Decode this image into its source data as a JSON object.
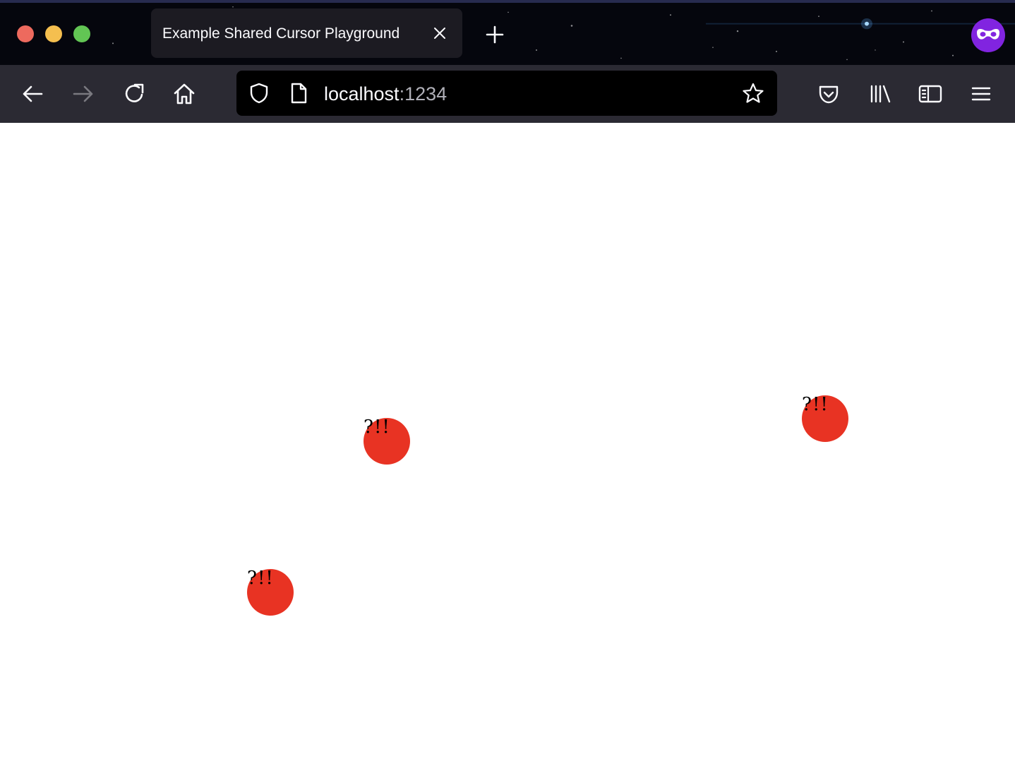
{
  "browser": {
    "tab": {
      "title": "Example Shared Cursor Playground",
      "close_icon": "close-icon"
    },
    "new_tab_icon": "plus-icon",
    "profile_icon": "private-browsing-mask-icon",
    "traffic_lights": {
      "close": "#ed6a5e",
      "minimize": "#f5bf4f",
      "maximize": "#62c554"
    },
    "nav": {
      "back_icon": "arrow-left-icon",
      "forward_icon": "arrow-right-icon",
      "reload_icon": "reload-icon",
      "home_icon": "home-icon"
    },
    "urlbar": {
      "host": "localhost",
      "port": ":1234",
      "shield_icon": "shield-icon",
      "page_icon": "page-icon",
      "bookmark_icon": "star-icon"
    },
    "toolbar": {
      "pocket_icon": "pocket-icon",
      "library_icon": "library-icon",
      "sidebar_icon": "sidebar-icon",
      "menu_icon": "hamburger-menu-icon"
    },
    "colors": {
      "titlebar": "#05060d",
      "navbar": "#2b2a33",
      "urlbar": "#000000",
      "tab": "#1c1b22"
    }
  },
  "page": {
    "background": "#ffffff",
    "cursor_color": "#e83323",
    "cursors": [
      {
        "label": "?!!"
      },
      {
        "label": "?!!"
      },
      {
        "label": "?!!"
      }
    ]
  }
}
